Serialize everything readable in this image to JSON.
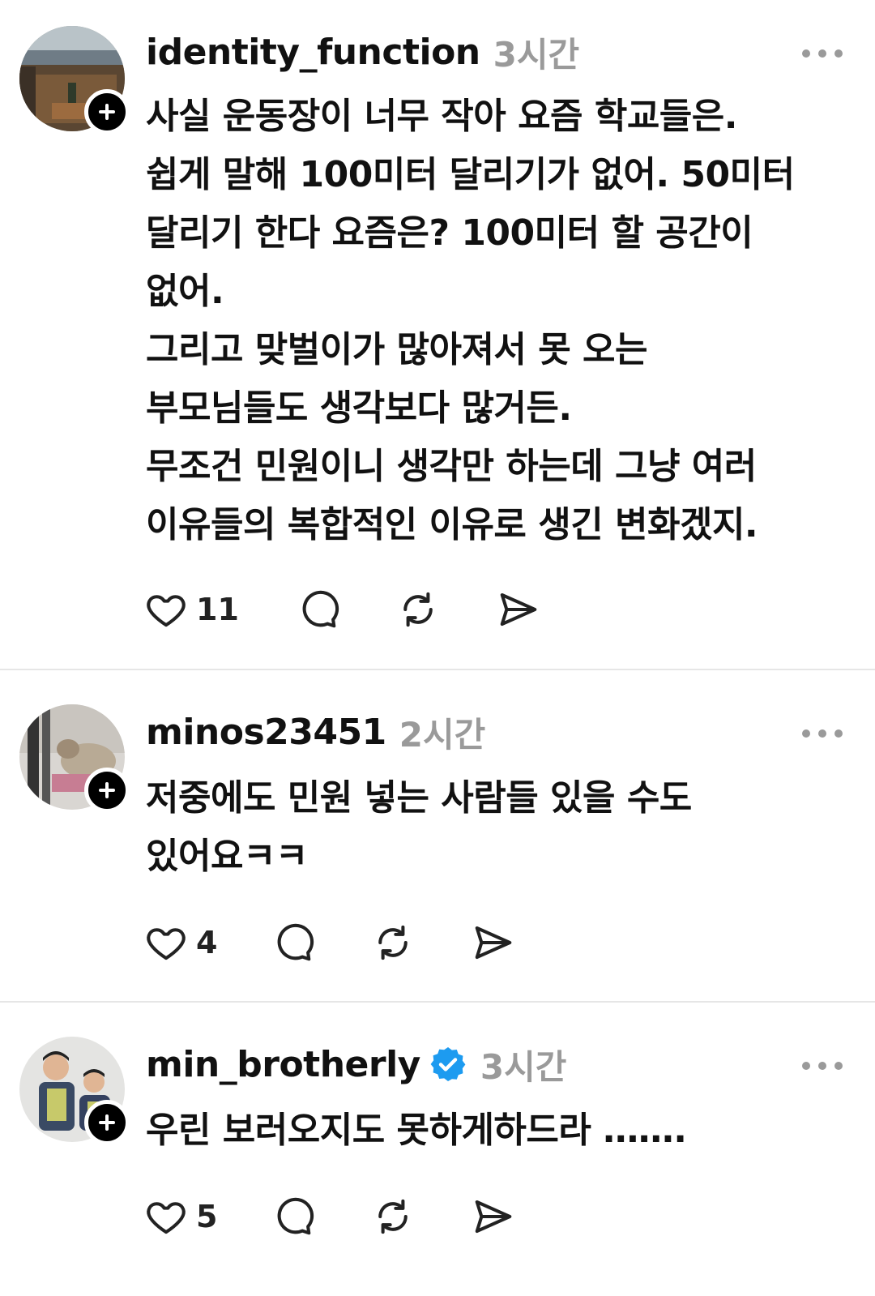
{
  "posts": [
    {
      "username": "identity_function",
      "time": "3시간",
      "verified": false,
      "text": "사실 운동장이 너무 작아 요즘 학교들은.\n쉽게 말해 100미터 달리기가 없어. 50미터\n달리기 한다 요즘은? 100미터 할 공간이\n없어.\n그리고 맞벌이가 많아져서 못 오는\n부모님들도 생각보다 많거든.\n무조건 민원이니 생각만 하는데 그냥 여러\n이유들의 복합적인 이유로 생긴 변화겠지.",
      "likes": "11"
    },
    {
      "username": "minos23451",
      "time": "2시간",
      "verified": false,
      "text": "저중에도 민원 넣는 사람들 있을 수도\n있어요ㅋㅋ",
      "likes": "4"
    },
    {
      "username": "min_brotherly",
      "time": "3시간",
      "verified": true,
      "text": "우린 보러오지도 못하게하드라 …….",
      "likes": "5"
    }
  ],
  "icons": {
    "like": "heart-icon",
    "comment": "comment-icon",
    "repost": "repost-icon",
    "share": "send-icon",
    "more": "more-icon",
    "follow": "plus-icon",
    "verified": "verified-badge-icon"
  },
  "colors": {
    "text": "#111111",
    "muted": "#9a9a9a",
    "verified": "#1d9bf0",
    "divider": "#e6e6e6"
  }
}
